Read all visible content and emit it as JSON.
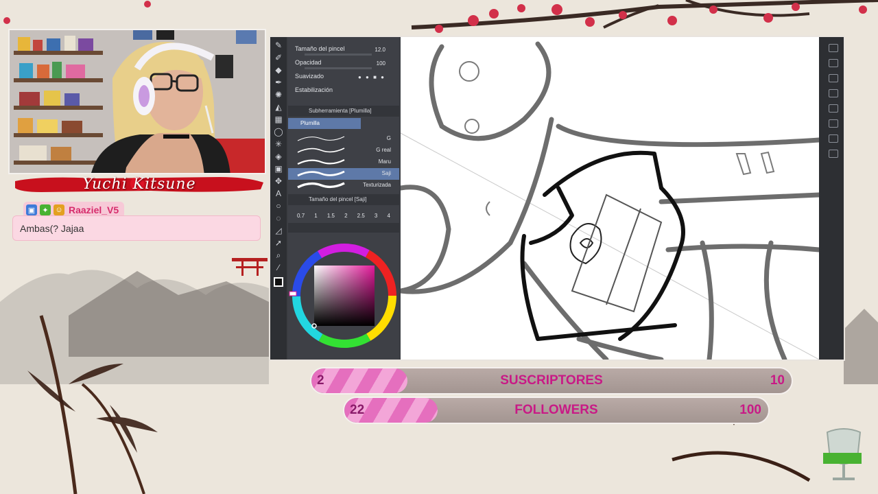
{
  "streamer": {
    "name": "Yuchi Kitsune"
  },
  "chat": {
    "username": "Raaziel_V5",
    "message": "Ambas(? Jajaa"
  },
  "app": {
    "tool_properties": {
      "brush_size_label": "Tamaño del pincel",
      "brush_size_value": "12.0",
      "opacity_label": "Opacidad",
      "opacity_value": "100",
      "smoothing_label": "Suavizado",
      "stabilization_label": "Estabilización"
    },
    "subtool": {
      "header": "Subherramienta [Plumilla]",
      "active_group": "Plumilla",
      "brushes": [
        {
          "name": "G"
        },
        {
          "name": "G real"
        },
        {
          "name": "Maru"
        },
        {
          "name": "Saji"
        },
        {
          "name": "Texturizada"
        }
      ],
      "selected_brush_index": 3
    },
    "brush_size_panel": {
      "header": "Tamaño del pincel [Saji]",
      "sizes": [
        "0.7",
        "1",
        "1.5",
        "2",
        "2.5",
        "3",
        "4"
      ]
    }
  },
  "goals": [
    {
      "current": "2",
      "label": "SUSCRIPTORES",
      "target": "10",
      "progress": 0.2
    },
    {
      "current": "22",
      "label": "FOLLOWERS",
      "target": "100",
      "progress": 0.22
    }
  ],
  "colors": {
    "accent_pink": "#e56fbe",
    "goal_text": "#c81a86",
    "nameplate_red": "#c8101d",
    "chat_user": "#d62c6c"
  }
}
